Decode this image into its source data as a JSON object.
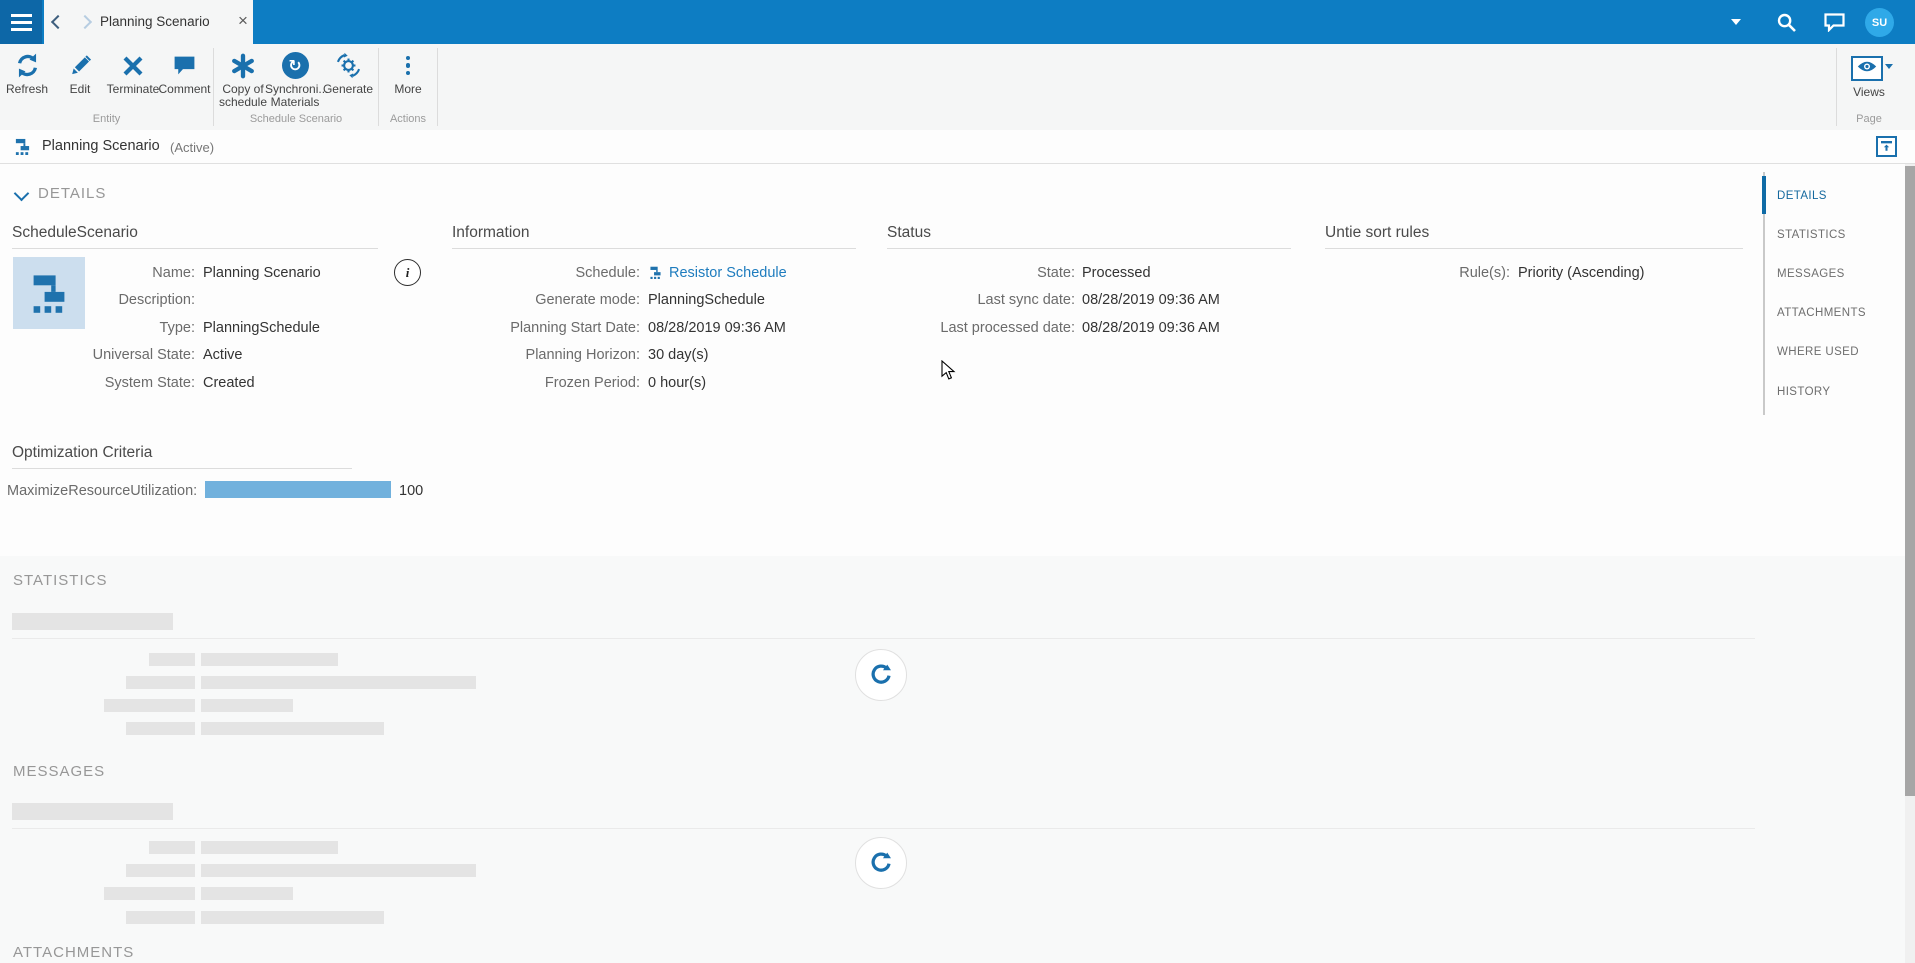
{
  "topbar": {
    "tab_title": "Planning Scenario",
    "avatar_initials": "SU"
  },
  "toolbar": {
    "buttons": {
      "refresh": "Refresh",
      "edit": "Edit",
      "terminate": "Terminate",
      "comment": "Comment",
      "copy_line1": "Copy of",
      "copy_line2": "schedule",
      "sync_line1": "Synchroni...",
      "sync_line2": "Materials",
      "generate": "Generate",
      "more": "More",
      "views": "Views"
    },
    "groups": {
      "entity": "Entity",
      "schedule_scenario": "Schedule Scenario",
      "actions": "Actions",
      "page": "Page"
    }
  },
  "entity_header": {
    "title": "Planning Scenario",
    "state": "(Active)"
  },
  "details": {
    "section_title": "DETAILS",
    "schedule_scenario": {
      "title": "ScheduleScenario",
      "fields": [
        {
          "label": "Name:",
          "value": "Planning Scenario"
        },
        {
          "label": "Description:",
          "value": ""
        },
        {
          "label": "Type:",
          "value": "PlanningSchedule"
        },
        {
          "label": "Universal State:",
          "value": "Active"
        },
        {
          "label": "System State:",
          "value": "Created"
        }
      ]
    },
    "information": {
      "title": "Information",
      "schedule_label": "Schedule:",
      "schedule_link": "Resistor Schedule",
      "fields": [
        {
          "label": "Generate mode:",
          "value": "PlanningSchedule"
        },
        {
          "label": "Planning Start Date:",
          "value": "08/28/2019 09:36 AM"
        },
        {
          "label": "Planning Horizon:",
          "value": "30 day(s)"
        },
        {
          "label": "Frozen Period:",
          "value": "0 hour(s)"
        }
      ]
    },
    "status": {
      "title": "Status",
      "fields": [
        {
          "label": "State:",
          "value": "Processed"
        },
        {
          "label": "Last sync date:",
          "value": "08/28/2019 09:36 AM"
        },
        {
          "label": "Last processed date:",
          "value": "08/28/2019 09:36 AM"
        }
      ]
    },
    "untie_sort_rules": {
      "title": "Untie sort rules",
      "fields": [
        {
          "label": "Rule(s):",
          "value": "Priority (Ascending)"
        }
      ]
    },
    "optimization_criteria": {
      "title": "Optimization Criteria",
      "label": "MaximizeResourceUtilization:",
      "value": "100"
    }
  },
  "sections": {
    "statistics": "STATISTICS",
    "messages": "MESSAGES",
    "attachments": "ATTACHMENTS"
  },
  "side_nav": {
    "active_item": "DETAILS",
    "items": [
      {
        "label": "DETAILS"
      },
      {
        "label": "STATISTICS"
      },
      {
        "label": "MESSAGES"
      },
      {
        "label": "ATTACHMENTS"
      },
      {
        "label": "WHERE USED"
      },
      {
        "label": "HISTORY"
      }
    ]
  },
  "colors": {
    "topbar_blue": "#0d7dc3",
    "hamburger_blue": "#0d67a7",
    "icon_blue": "#1a70ad",
    "link_blue": "#1e7cbe",
    "avatar_blue": "#2fa9e8",
    "progress_bar_blue": "#71b1dd",
    "active_nav_blue": "#15699e"
  }
}
